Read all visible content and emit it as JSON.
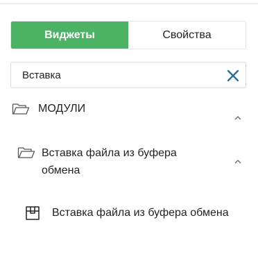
{
  "tabs": [
    {
      "label": "Виджеты",
      "active": true
    },
    {
      "label": "Свойства",
      "active": false
    }
  ],
  "search": {
    "value": "Вставка",
    "placeholder": ""
  },
  "tree": {
    "group": {
      "label": "МОДУЛИ",
      "icon": "folder-open-icon",
      "expanded": true
    },
    "subgroup": {
      "label_line1": "Вставка файла из буфера",
      "label_line2": "обмена",
      "icon": "folder-open-icon",
      "expanded": true
    },
    "item": {
      "label": "Вставка файла из буфера обмена",
      "icon": "box-icon"
    }
  },
  "colors": {
    "accent": "#4cb365",
    "clear_icon": "#2a6f97",
    "icon_gray": "#555555"
  }
}
